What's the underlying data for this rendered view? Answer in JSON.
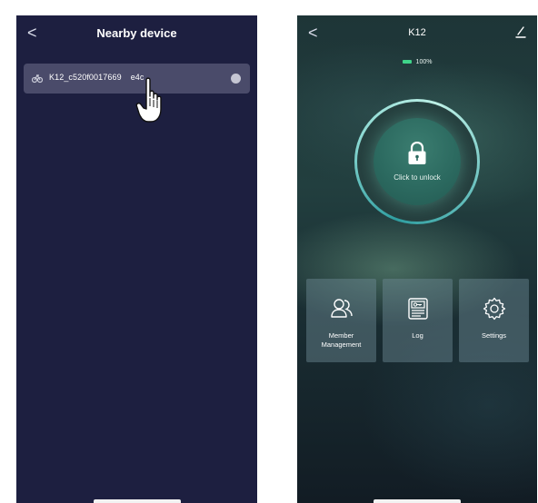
{
  "left_screen": {
    "back_glyph": "<",
    "title": "Nearby device",
    "devices": [
      {
        "name": "K12_c520f0017669",
        "name_tail": "e4c",
        "icon": "bike-icon"
      }
    ]
  },
  "right_screen": {
    "back_glyph": "<",
    "title": "K12",
    "edit_icon": "edit-icon",
    "battery": "100%",
    "unlock_label": "Click to unlock",
    "tiles": [
      {
        "label_line1": "Member",
        "label_line2": "Management",
        "icon": "users-icon"
      },
      {
        "label_line1": "Log",
        "label_line2": "",
        "icon": "log-icon"
      },
      {
        "label_line1": "Settings",
        "label_line2": "",
        "icon": "gear-icon"
      }
    ]
  },
  "colors": {
    "left_bg": "#1d1f40",
    "device_item_bg": "#4a4b6a",
    "battery_green": "#3fd48a",
    "ring_accent": "#8ad8d2"
  }
}
